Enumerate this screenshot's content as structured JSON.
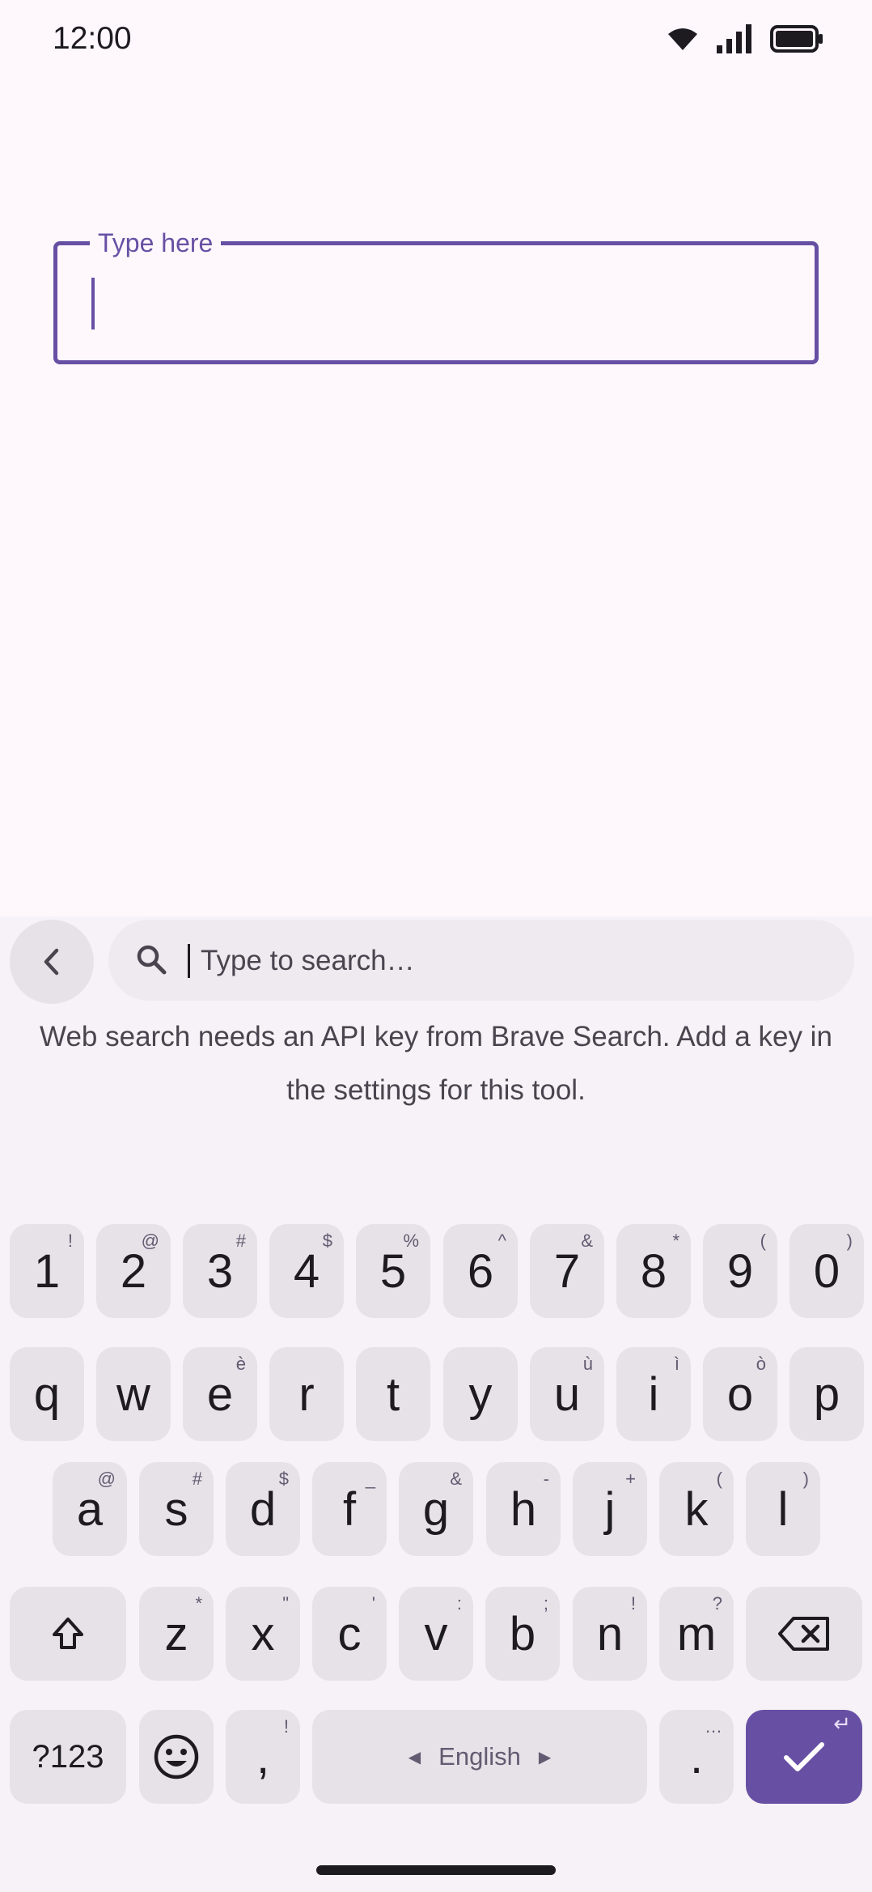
{
  "status_bar": {
    "time": "12:00",
    "icons": [
      "wifi-icon",
      "signal-icon",
      "battery-icon"
    ]
  },
  "field": {
    "label": "Type here",
    "value": ""
  },
  "keyboard": {
    "search_placeholder": "Type to search…",
    "message": "Web search needs an API key from Brave Search. Add a key in the settings for this tool.",
    "row1": [
      {
        "k": "1",
        "h": "!"
      },
      {
        "k": "2",
        "h": "@"
      },
      {
        "k": "3",
        "h": "#"
      },
      {
        "k": "4",
        "h": "$"
      },
      {
        "k": "5",
        "h": "%"
      },
      {
        "k": "6",
        "h": "^"
      },
      {
        "k": "7",
        "h": "&"
      },
      {
        "k": "8",
        "h": "*"
      },
      {
        "k": "9",
        "h": "("
      },
      {
        "k": "0",
        "h": ")"
      }
    ],
    "row2": [
      {
        "k": "q",
        "h": ""
      },
      {
        "k": "w",
        "h": ""
      },
      {
        "k": "e",
        "h": "è"
      },
      {
        "k": "r",
        "h": ""
      },
      {
        "k": "t",
        "h": ""
      },
      {
        "k": "y",
        "h": ""
      },
      {
        "k": "u",
        "h": "ù"
      },
      {
        "k": "i",
        "h": "ì"
      },
      {
        "k": "o",
        "h": "ò"
      },
      {
        "k": "p",
        "h": ""
      }
    ],
    "row3": [
      {
        "k": "a",
        "h": "@"
      },
      {
        "k": "s",
        "h": "#"
      },
      {
        "k": "d",
        "h": "$"
      },
      {
        "k": "f",
        "h": "_"
      },
      {
        "k": "g",
        "h": "&"
      },
      {
        "k": "h",
        "h": "-"
      },
      {
        "k": "j",
        "h": "+"
      },
      {
        "k": "k",
        "h": "("
      },
      {
        "k": "l",
        "h": ")"
      }
    ],
    "row4": [
      {
        "k": "z",
        "h": "*"
      },
      {
        "k": "x",
        "h": "\""
      },
      {
        "k": "c",
        "h": "'"
      },
      {
        "k": "v",
        "h": ":"
      },
      {
        "k": "b",
        "h": ";"
      },
      {
        "k": "n",
        "h": "!"
      },
      {
        "k": "m",
        "h": "?"
      }
    ],
    "symbols_label": "?123",
    "comma": {
      "k": ",",
      "h": "!"
    },
    "space_label": "English",
    "period": {
      "k": ".",
      "h": "…"
    },
    "enter_hint": "↵",
    "accent": "#6750a4"
  }
}
